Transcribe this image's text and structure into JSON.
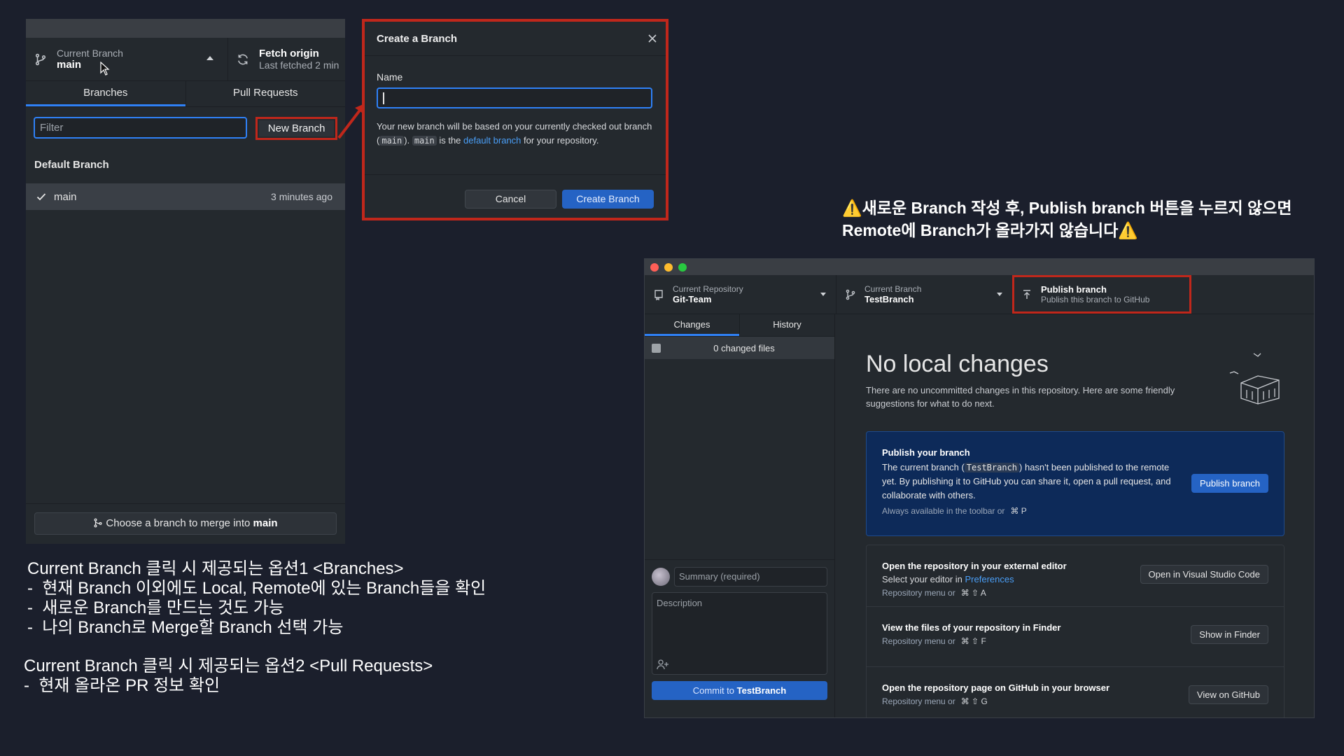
{
  "branch_panel": {
    "current_branch_label": "Current Branch",
    "current_branch_name": "main",
    "fetch_title": "Fetch origin",
    "fetch_sub": "Last fetched 2 min",
    "tabs": [
      "Branches",
      "Pull Requests"
    ],
    "filter_placeholder": "Filter",
    "new_branch_label": "New Branch",
    "section_title": "Default Branch",
    "branches": [
      {
        "name": "main",
        "time": "3 minutes ago"
      }
    ],
    "merge_prefix": "Choose a branch to merge into ",
    "merge_target": "main"
  },
  "dialog": {
    "title": "Create a Branch",
    "name_label": "Name",
    "desc_1": "Your new branch will be based on your currently checked out branch (",
    "desc_code_1": "main",
    "desc_2": "). ",
    "desc_code_2": "main",
    "desc_3": " is the ",
    "desc_link": "default branch",
    "desc_4": " for your repository.",
    "cancel": "Cancel",
    "create": "Create Branch"
  },
  "captions": {
    "options_1": "Current Branch 클릭 시 제공되는 옵션1 <Branches>\n-  현재 Branch 이외에도 Local, Remote에 있는 Branch들을 확인\n-  새로운 Branch를 만드는 것도 가능\n-  나의 Branch로 Merge할 Branch 선택 가능",
    "options_2": "Current Branch 클릭 시 제공되는 옵션2 <Pull Requests>\n-  현재 올라온 PR 정보 확인",
    "warning": "⚠️새로운 Branch 작성 후, Publish branch 버튼을 누르지 않으면\nRemote에 Branch가 올라가지 않습니다⚠️"
  },
  "repo_window": {
    "repo_label": "Current Repository",
    "repo_name": "Git-Team",
    "branch_label": "Current Branch",
    "branch_name": "TestBranch",
    "publish_title": "Publish branch",
    "publish_sub": "Publish this branch to GitHub",
    "tabs": [
      "Changes",
      "History"
    ],
    "changed_files": "0 changed files",
    "summary_placeholder": "Summary (required)",
    "description_placeholder": "Description",
    "commit_prefix": "Commit to ",
    "commit_branch": "TestBranch",
    "no_changes_title": "No local changes",
    "no_changes_sub": "There are no uncommitted changes in this repository. Here are some friendly suggestions for what to do next.",
    "publish_card": {
      "title": "Publish your branch",
      "text_1": "The current branch (",
      "code": "TestBranch",
      "text_2": ") hasn't been published to the remote yet. By publishing it to GitHub you can share it, open a pull request, and collaborate with others.",
      "hint": "Always available in the toolbar or",
      "keys": "⌘   P",
      "button": "Publish branch"
    },
    "options": [
      {
        "title": "Open the repository in your external editor",
        "sub_text": "Select your editor in ",
        "sub_link": "Preferences",
        "hint": "Repository menu or",
        "keys": "⌘   ⇧   A",
        "button": "Open in Visual Studio Code"
      },
      {
        "title": "View the files of your repository in Finder",
        "hint": "Repository menu or",
        "keys": "⌘   ⇧   F",
        "button": "Show in Finder"
      },
      {
        "title": "Open the repository page on GitHub in your browser",
        "hint": "Repository menu or",
        "keys": "⌘   ⇧   G",
        "button": "View on GitHub"
      }
    ],
    "colors": {
      "accent": "#2f81f7",
      "highlight_border": "#c0271b",
      "publish_card_bg": "#0d2a59"
    }
  }
}
